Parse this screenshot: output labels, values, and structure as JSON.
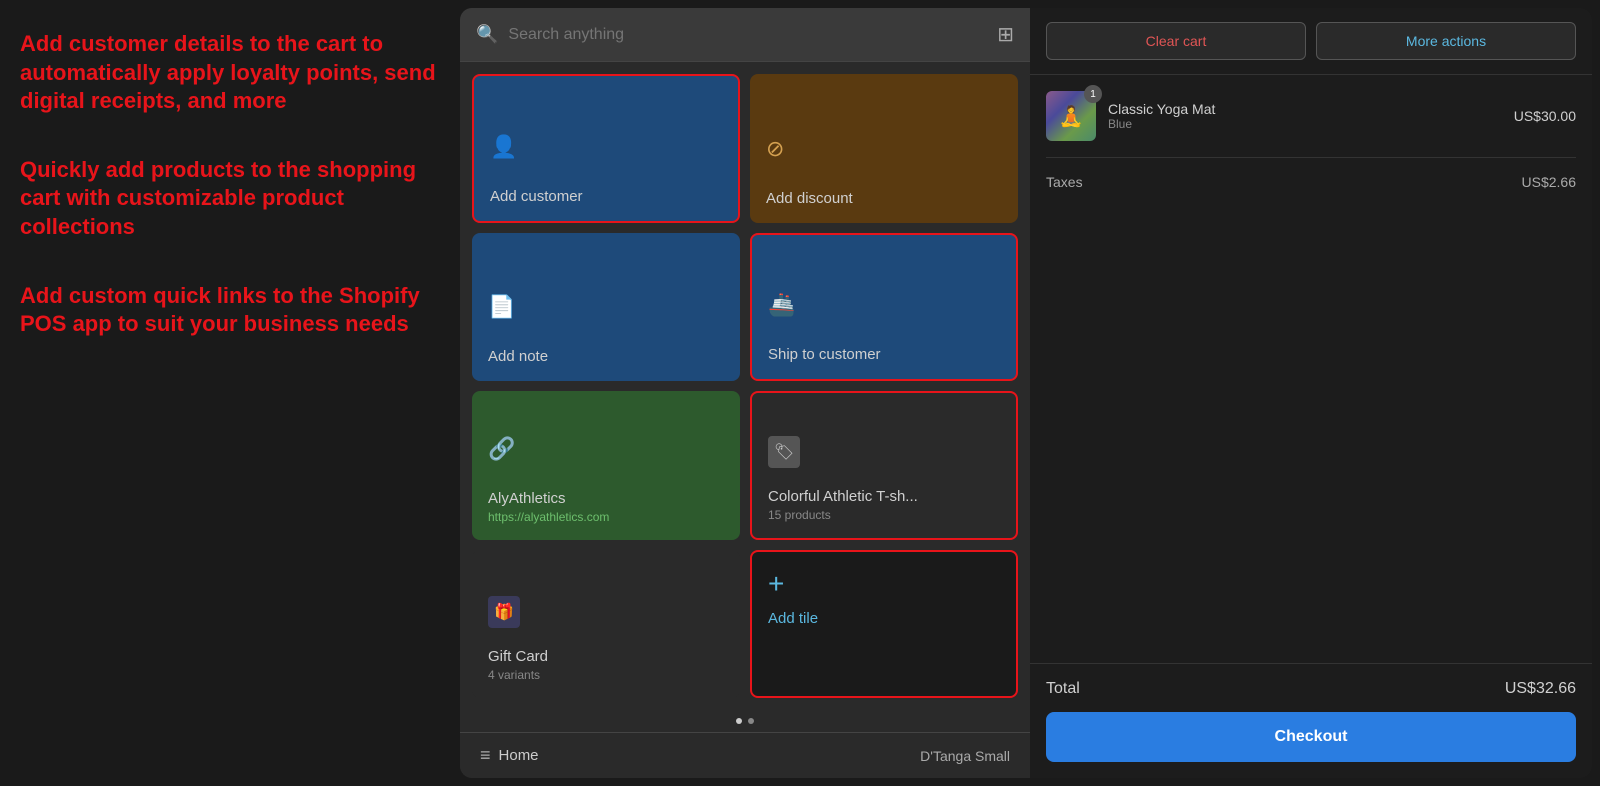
{
  "annotations": [
    {
      "id": "annotation-1",
      "text": "Add customer details to the cart to automatically apply loyalty points, send digital receipts, and more"
    },
    {
      "id": "annotation-2",
      "text": "Quickly add products to the shopping cart with customizable product collections"
    },
    {
      "id": "annotation-3",
      "text": "Add custom quick links to the Shopify POS app to suit your business needs"
    }
  ],
  "search": {
    "placeholder": "Search anything"
  },
  "tiles": [
    {
      "id": "add-customer",
      "label": "Add customer",
      "icon": "person",
      "type": "add-customer"
    },
    {
      "id": "add-discount",
      "label": "Add discount",
      "icon": "discount",
      "type": "add-discount"
    },
    {
      "id": "add-note",
      "label": "Add note",
      "icon": "note",
      "type": "add-note"
    },
    {
      "id": "ship-to-customer",
      "label": "Ship to customer",
      "icon": "ship",
      "type": "ship-to-customer"
    },
    {
      "id": "aly-athletics",
      "label": "AlyAthletics",
      "sublabel": "https://alyathletics.com",
      "icon": "link",
      "type": "aly-athletics"
    },
    {
      "id": "colorful-athletic",
      "label": "Colorful Athletic T-sh...",
      "sublabel": "15 products",
      "icon": "product",
      "type": "colorful-athletic"
    },
    {
      "id": "gift-card",
      "label": "Gift Card",
      "sublabel": "4 variants",
      "icon": "gift",
      "type": "gift-card"
    },
    {
      "id": "add-tile",
      "label": "Add tile",
      "icon": "plus",
      "type": "add-tile"
    }
  ],
  "cart": {
    "header": {
      "clear_cart_label": "Clear cart",
      "more_actions_label": "More actions"
    },
    "items": [
      {
        "name": "Classic Yoga Mat",
        "variant": "Blue",
        "price": "US$30.00",
        "quantity": 1
      }
    ],
    "taxes_label": "Taxes",
    "taxes_value": "US$2.66",
    "total_label": "Total",
    "total_value": "US$32.66",
    "checkout_label": "Checkout"
  },
  "nav": {
    "home_label": "Home",
    "store_label": "D'Tanga Small"
  },
  "colors": {
    "accent_blue": "#2a7de1",
    "clear_cart_red": "#e05555",
    "more_actions_blue": "#5bb8e0"
  }
}
